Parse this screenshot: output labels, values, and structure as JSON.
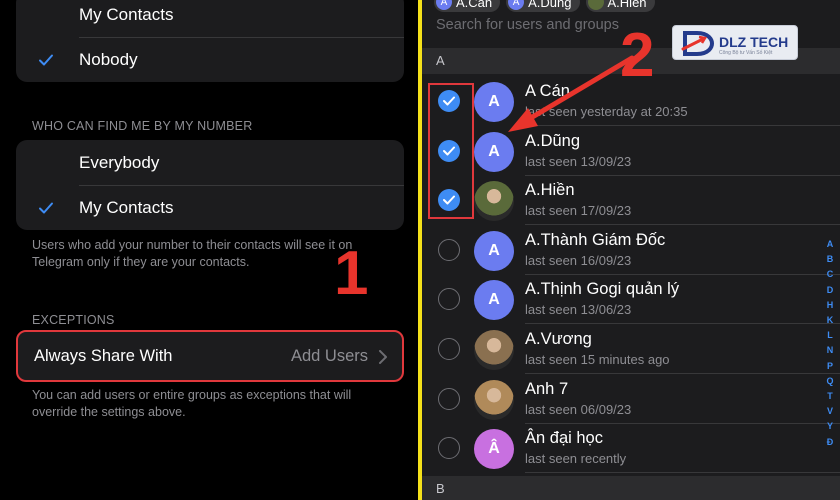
{
  "left": {
    "privacy_top": {
      "items": [
        {
          "label": "My Contacts",
          "checked": false
        },
        {
          "label": "Nobody",
          "checked": true
        }
      ]
    },
    "find_by_number": {
      "header": "WHO CAN FIND ME BY MY NUMBER",
      "items": [
        {
          "label": "Everybody",
          "checked": false
        },
        {
          "label": "My Contacts",
          "checked": true
        }
      ],
      "footer": "Users who add your number to their contacts will see it on Telegram only if they are your contacts."
    },
    "exceptions": {
      "header": "EXCEPTIONS",
      "always_share_label": "Always Share With",
      "always_share_value": "Add Users",
      "footer": "You can add users or entire groups as exceptions that will override the settings above."
    },
    "annotation_number": "1"
  },
  "right": {
    "selected_chips": [
      {
        "initial": "A",
        "name": "A.Cán"
      },
      {
        "initial": "A",
        "name": "A.Dũng"
      },
      {
        "initial": "",
        "name": "A.Hiền"
      }
    ],
    "search_placeholder": "Search for users and groups",
    "section_a": "A",
    "section_b": "B",
    "contacts": [
      {
        "name": "A Cán",
        "seen": "last seen yesterday at 20:35",
        "initial": "A",
        "selected": true,
        "avatar_color": "#6b7cf0",
        "photo": false
      },
      {
        "name": "A.Dũng",
        "seen": "last seen 13/09/23",
        "initial": "A",
        "selected": true,
        "avatar_color": "#6b7cf0",
        "photo": false
      },
      {
        "name": "A.Hiền",
        "seen": "last seen 17/09/23",
        "initial": "",
        "selected": true,
        "avatar_color": "#5a6a3a",
        "photo": true
      },
      {
        "name": "A.Thành Giám Đốc",
        "seen": "last seen 16/09/23",
        "initial": "A",
        "selected": false,
        "avatar_color": "#6b7cf0",
        "photo": false
      },
      {
        "name": "A.Thịnh Gogi quản lý",
        "seen": "last seen 13/06/23",
        "initial": "A",
        "selected": false,
        "avatar_color": "#6b7cf0",
        "photo": false
      },
      {
        "name": "A.Vương",
        "seen": "last seen 15 minutes ago",
        "initial": "",
        "selected": false,
        "avatar_color": "#8a7050",
        "photo": true
      },
      {
        "name": "Anh 7",
        "seen": "last seen 06/09/23",
        "initial": "",
        "selected": false,
        "avatar_color": "#b08a5a",
        "photo": true
      },
      {
        "name": "Ân đại học",
        "seen": "last seen recently",
        "initial": "Â",
        "selected": false,
        "avatar_color": "#c870e0",
        "photo": false
      }
    ],
    "alphabet_index": [
      "A",
      "B",
      "C",
      "D",
      "H",
      "K",
      "L",
      "N",
      "P",
      "Q",
      "T",
      "V",
      "Y",
      "Đ"
    ],
    "annotation_number": "2",
    "logo_text": "DLZ TECH",
    "logo_tagline": "Công Bộ tư Vấn Số Kiệt"
  },
  "colors": {
    "accent_blue": "#3e8cf4",
    "highlight_red": "#e0383c",
    "divider_yellow": "#f5e11a"
  }
}
